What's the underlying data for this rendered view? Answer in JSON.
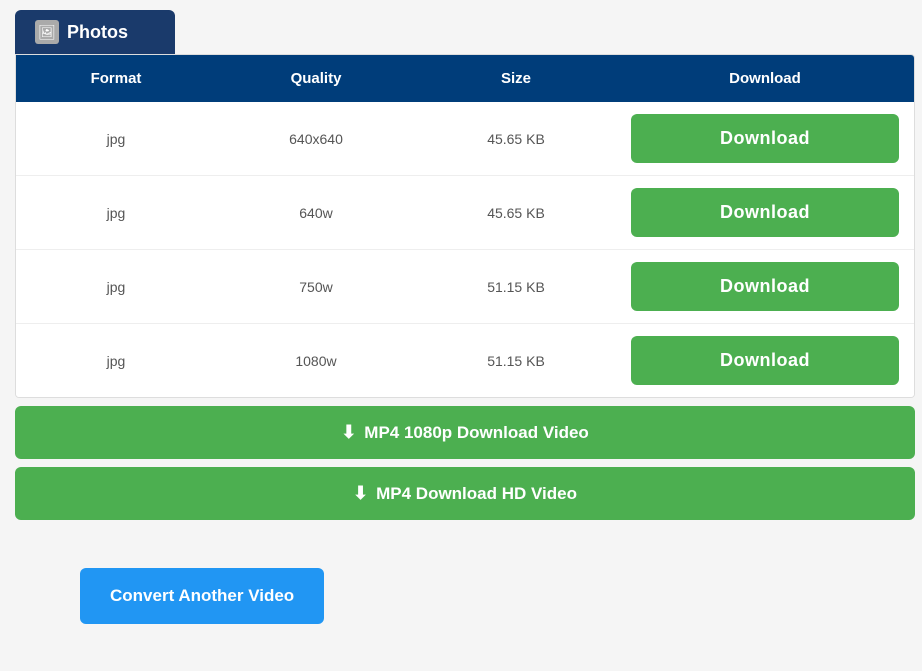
{
  "tab": {
    "icon": "🖼",
    "label": "Photos"
  },
  "table": {
    "headers": {
      "format": "Format",
      "quality": "Quality",
      "size": "Size",
      "download": "Download"
    },
    "rows": [
      {
        "format": "jpg",
        "quality": "640x640",
        "size": "45.65 KB",
        "download_label": "Download"
      },
      {
        "format": "jpg",
        "quality": "640w",
        "size": "45.65 KB",
        "download_label": "Download"
      },
      {
        "format": "jpg",
        "quality": "750w",
        "size": "51.15 KB",
        "download_label": "Download"
      },
      {
        "format": "jpg",
        "quality": "1080w",
        "size": "51.15 KB",
        "download_label": "Download"
      }
    ]
  },
  "video_buttons": [
    {
      "id": "mp4-1080p",
      "label": "MP4 1080p Download Video"
    },
    {
      "id": "mp4-hd",
      "label": "MP4 Download HD Video"
    }
  ],
  "convert_button": {
    "label": "Convert Another Video"
  },
  "colors": {
    "header_bg": "#003d7a",
    "tab_bg": "#1a3a6b",
    "green": "#4caf50",
    "blue": "#2196f3"
  }
}
